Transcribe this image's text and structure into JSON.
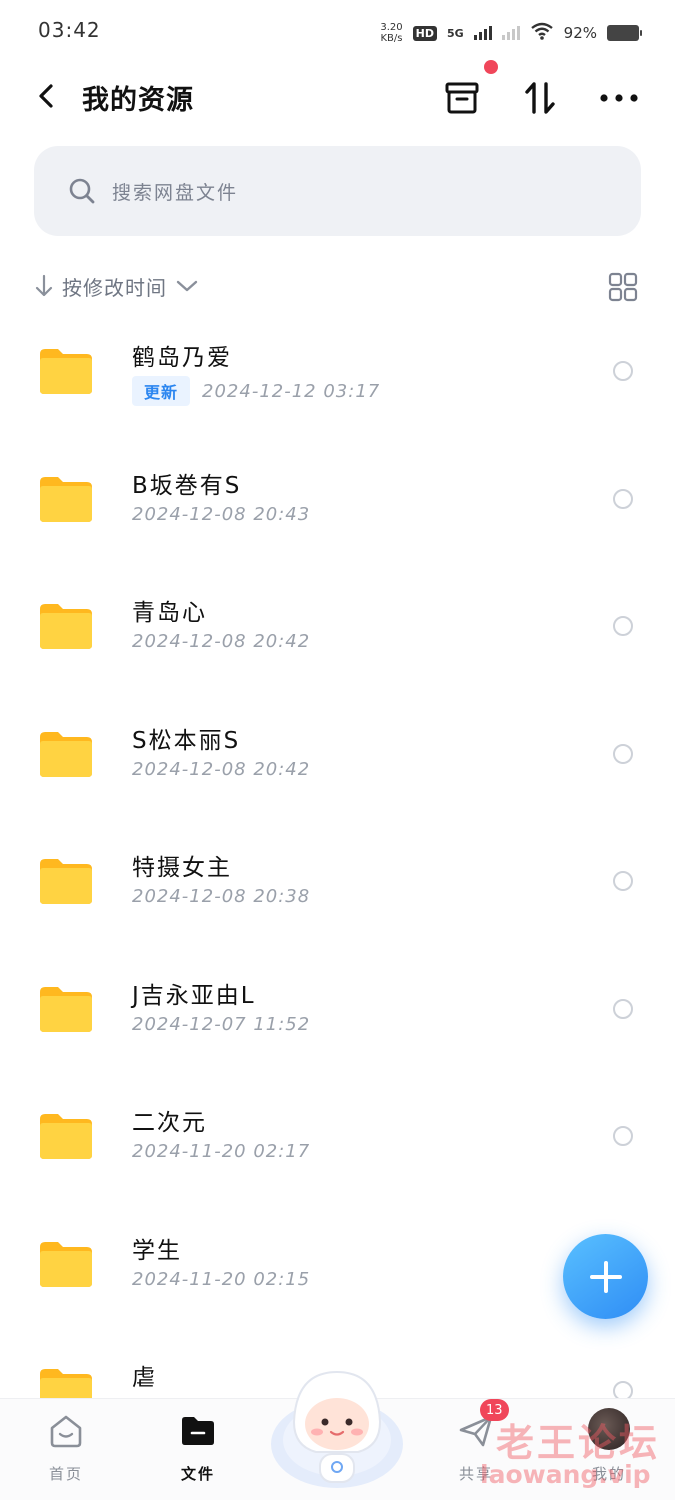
{
  "status_bar": {
    "time": "03:42",
    "net_speed_value": "3.20",
    "net_speed_unit": "KB/s",
    "hd": "HD",
    "network": "5G",
    "battery": "92%"
  },
  "header": {
    "title": "我的资源"
  },
  "search": {
    "placeholder": "搜索网盘文件"
  },
  "sort": {
    "label": "按修改时间"
  },
  "files": [
    {
      "name": "鹤岛乃爱",
      "badge": "更新",
      "date": "2024-12-12  03:17"
    },
    {
      "name": "B坂巻有S",
      "badge": "",
      "date": "2024-12-08  20:43"
    },
    {
      "name": "青岛心",
      "badge": "",
      "date": "2024-12-08  20:42"
    },
    {
      "name": "S松本丽S",
      "badge": "",
      "date": "2024-12-08  20:42"
    },
    {
      "name": "特摄女主",
      "badge": "",
      "date": "2024-12-08  20:38"
    },
    {
      "name": "J吉永亚由L",
      "badge": "",
      "date": "2024-12-07  11:52"
    },
    {
      "name": "二次元",
      "badge": "",
      "date": "2024-11-20  02:17"
    },
    {
      "name": "学生",
      "badge": "",
      "date": "2024-11-20  02:15"
    },
    {
      "name": "虐",
      "badge": "",
      "date": ""
    }
  ],
  "nav": {
    "home": "首页",
    "files": "文件",
    "share": "共享",
    "share_badge": "13",
    "mine": "我的"
  },
  "watermark": {
    "line1": "老王论坛",
    "line2": "laowang.vip"
  },
  "colors": {
    "accent": "#2f8df5",
    "folder": "#ffc933",
    "badge_red": "#f0465a"
  },
  "icons": [
    "back-arrow-icon",
    "archive-box-icon",
    "sort-arrows-icon",
    "more-dots-icon",
    "search-icon",
    "arrow-down-icon",
    "chevron-down-icon",
    "grid-view-icon",
    "folder-icon",
    "plus-icon",
    "home-icon",
    "file-folder-icon",
    "paper-plane-icon"
  ]
}
